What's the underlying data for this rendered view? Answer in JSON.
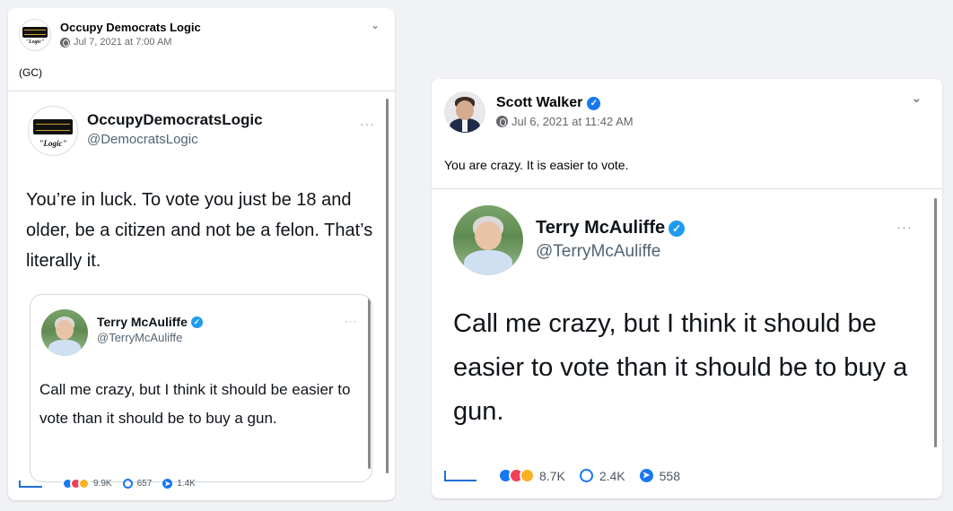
{
  "left_post": {
    "page_name": "Occupy Democrats Logic",
    "date": "Jul 7, 2021 at 7:00 AM",
    "caption": "(GC)",
    "avatar_top_text": "OCCUPY",
    "avatar_mid_text": "DEMOCRATS",
    "avatar_logic_text": "\"Logic\"",
    "tweet": {
      "name": "OccupyDemocratsLogic",
      "handle": "@DemocratsLogic",
      "more": "···",
      "text": "You’re in luck. To vote you just be 18 and older, be a citizen and not be a felon. That’s literally it.",
      "quoted": {
        "name": "Terry McAuliffe",
        "handle": "@TerryMcAuliffe",
        "more": "···",
        "text": "Call me crazy, but I think it should be easier to vote than it should be to buy a gun."
      }
    },
    "stats": {
      "reactions": "9.9K",
      "comments": "657",
      "shares": "1.4K"
    }
  },
  "right_post": {
    "page_name": "Scott Walker",
    "date": "Jul 6, 2021 at 11:42 AM",
    "caption": "You are crazy. It is easier to vote.",
    "tweet": {
      "name": "Terry McAuliffe",
      "handle": "@TerryMcAuliffe",
      "more": "···",
      "text": "Call me crazy, but I think it should be easier to vote than it should be to buy a gun."
    },
    "stats": {
      "reactions": "8.7K",
      "comments": "2.4K",
      "shares": "558"
    }
  },
  "colors": {
    "facebook_blue": "#1877f2",
    "twitter_blue": "#1d9bf0",
    "like_blue": "#1877f2",
    "love_red": "#f33e58",
    "haha_yellow": "#f7b125"
  },
  "icons": {
    "verified": "verified-badge-icon",
    "globe": "globe-icon",
    "chevron": "chevron-down-icon",
    "comment": "comment-icon",
    "share": "share-icon"
  }
}
